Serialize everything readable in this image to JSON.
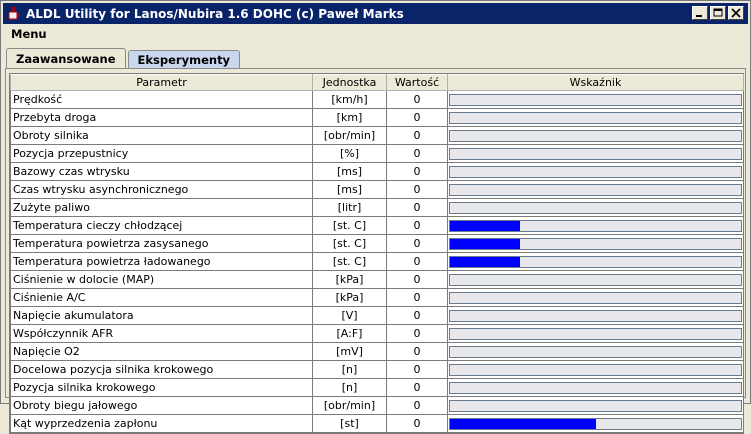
{
  "window": {
    "title": "ALDL Utility for Lanos/Nubira 1.6 DOHC (c) Paweł Marks"
  },
  "menu": [
    {
      "label": "Menu"
    }
  ],
  "tabs": [
    {
      "label": "Zaawansowane",
      "active": true
    },
    {
      "label": "Eksperymenty",
      "active": false
    }
  ],
  "table": {
    "headers": {
      "param": "Parametr",
      "unit": "Jednostka",
      "value": "Wartość",
      "meter": "Wskaźnik"
    },
    "rows": [
      {
        "param": "Prędkość",
        "unit": "[km/h]",
        "value": "0",
        "level": 0
      },
      {
        "param": "Przebyta droga",
        "unit": "[km]",
        "value": "0",
        "level": 0
      },
      {
        "param": "Obroty silnika",
        "unit": "[obr/min]",
        "value": "0",
        "level": 0
      },
      {
        "param": "Pozycja przepustnicy",
        "unit": "[%]",
        "value": "0",
        "level": 0
      },
      {
        "param": "Bazowy czas wtrysku",
        "unit": "[ms]",
        "value": "0",
        "level": 0
      },
      {
        "param": "Czas wtrysku asynchronicznego",
        "unit": "[ms]",
        "value": "0",
        "level": 0
      },
      {
        "param": "Zużyte paliwo",
        "unit": "[litr]",
        "value": "0",
        "level": 0
      },
      {
        "param": "Temperatura cieczy chłodzącej",
        "unit": "[st. C]",
        "value": "0",
        "level": 0.24
      },
      {
        "param": "Temperatura powietrza zasysanego",
        "unit": "[st. C]",
        "value": "0",
        "level": 0.24
      },
      {
        "param": "Temperatura powietrza ładowanego",
        "unit": "[st. C]",
        "value": "0",
        "level": 0.24
      },
      {
        "param": "Ciśnienie w dolocie (MAP)",
        "unit": "[kPa]",
        "value": "0",
        "level": 0
      },
      {
        "param": "Ciśnienie A/C",
        "unit": "[kPa]",
        "value": "0",
        "level": 0
      },
      {
        "param": "Napięcie akumulatora",
        "unit": "[V]",
        "value": "0",
        "level": 0
      },
      {
        "param": "Współczynnik AFR",
        "unit": "[A:F]",
        "value": "0",
        "level": 0
      },
      {
        "param": "Napięcie O2",
        "unit": "[mV]",
        "value": "0",
        "level": 0
      },
      {
        "param": "Docelowa pozycja silnika krokowego",
        "unit": "[n]",
        "value": "0",
        "level": 0
      },
      {
        "param": "Pozycja silnika krokowego",
        "unit": "[n]",
        "value": "0",
        "level": 0
      },
      {
        "param": "Obroty biegu jałowego",
        "unit": "[obr/min]",
        "value": "0",
        "level": 0
      },
      {
        "param": "Kąt wyprzedzenia zapłonu",
        "unit": "[st]",
        "value": "0",
        "level": 0.5
      }
    ]
  },
  "colors": {
    "meter_fill": "#0000ff",
    "titlebar": "#0a246a"
  },
  "icons": {
    "app": "java-cup-icon",
    "minimize": "minimize-icon",
    "maximize": "maximize-icon",
    "close": "close-icon"
  }
}
